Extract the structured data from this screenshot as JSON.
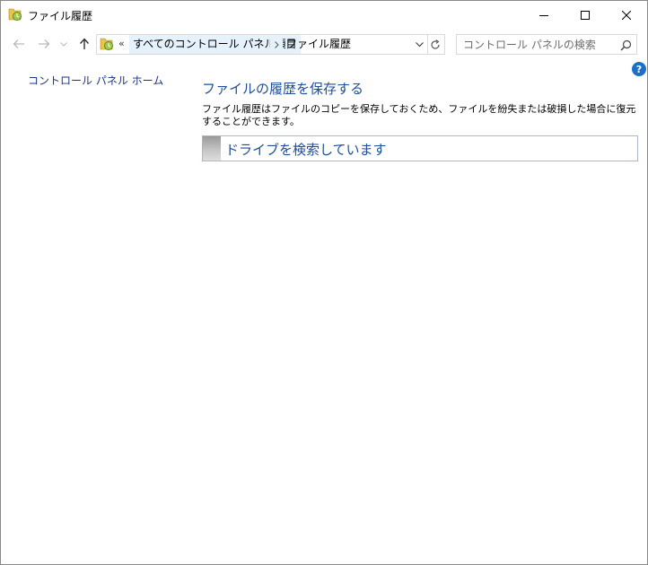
{
  "window": {
    "title": "ファイル履歴",
    "icon": "file-history-icon"
  },
  "address_bar": {
    "overflow": "«",
    "crumbs": [
      "すべてのコントロール パネル項目",
      "ファイル履歴"
    ]
  },
  "search": {
    "placeholder": "コントロール パネルの検索"
  },
  "help": {
    "label": "?"
  },
  "left_pane": {
    "home_link": "コントロール パネル ホーム"
  },
  "main": {
    "heading": "ファイルの履歴を保存する",
    "description": "ファイル履歴はファイルのコピーを保存しておくため、ファイルを紛失または破損した場合に復元することができます。",
    "status": "ドライブを検索しています"
  },
  "colors": {
    "link": "#1e3287",
    "heading": "#1e4e9c",
    "help_badge": "#1b6fc6",
    "crumb_hover": "#e5f1fb"
  }
}
